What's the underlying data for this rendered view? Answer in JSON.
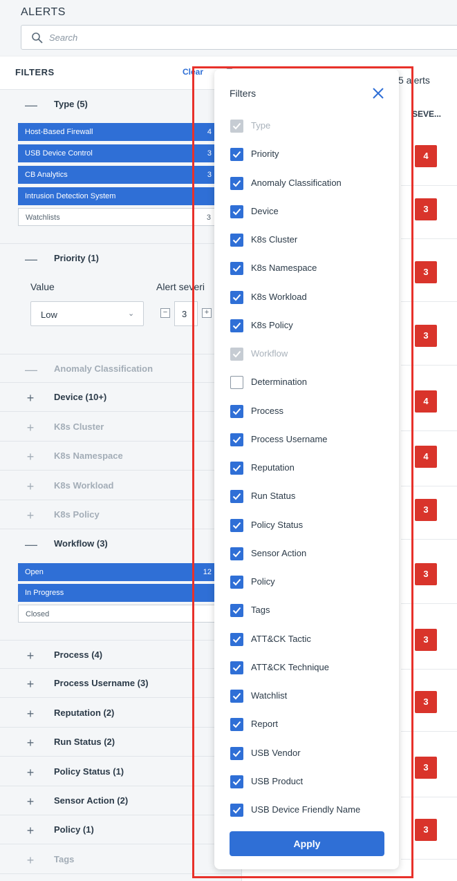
{
  "app": {
    "title": "ALERTS"
  },
  "search": {
    "placeholder": "Search"
  },
  "filters_panel": {
    "title": "FILTERS",
    "clear_label": "Clear",
    "type": {
      "label": "Type (5)",
      "chips": [
        {
          "label": "Host-Based Firewall",
          "count": "4",
          "selected": true
        },
        {
          "label": "USB Device Control",
          "count": "3",
          "selected": true
        },
        {
          "label": "CB Analytics",
          "count": "3",
          "selected": true
        },
        {
          "label": "Intrusion Detection System",
          "count": "",
          "selected": true
        },
        {
          "label": "Watchlists",
          "count": "3",
          "selected": false
        }
      ]
    },
    "priority": {
      "label": "Priority (1)",
      "value_label": "Value",
      "severity_label": "Alert severi",
      "value_selected": "Low",
      "severity_value": "3"
    },
    "collapsed_sections_a": [
      {
        "label": "Anomaly Classification",
        "toggle": "—",
        "muted": true
      },
      {
        "label": "Device (10+)",
        "toggle": "+",
        "muted": false
      },
      {
        "label": "K8s Cluster",
        "toggle": "+",
        "muted": true
      },
      {
        "label": "K8s Namespace",
        "toggle": "+",
        "muted": true
      },
      {
        "label": "K8s Workload",
        "toggle": "+",
        "muted": true
      },
      {
        "label": "K8s Policy",
        "toggle": "+",
        "muted": true
      }
    ],
    "workflow": {
      "label": "Workflow (3)",
      "chips": [
        {
          "label": "Open",
          "count": "12",
          "selected": true
        },
        {
          "label": "In Progress",
          "count": "",
          "selected": true
        },
        {
          "label": "Closed",
          "count": "",
          "selected": false
        }
      ]
    },
    "collapsed_sections_b": [
      {
        "label": "Process (4)",
        "toggle": "+",
        "muted": false
      },
      {
        "label": "Process Username (3)",
        "toggle": "+",
        "muted": false
      },
      {
        "label": "Reputation (2)",
        "toggle": "+",
        "muted": false
      },
      {
        "label": "Run Status (2)",
        "toggle": "+",
        "muted": false
      },
      {
        "label": "Policy Status (1)",
        "toggle": "+",
        "muted": false
      },
      {
        "label": "Sensor Action (2)",
        "toggle": "+",
        "muted": false
      },
      {
        "label": "Policy (1)",
        "toggle": "+",
        "muted": false
      },
      {
        "label": "Tags",
        "toggle": "+",
        "muted": true
      }
    ]
  },
  "alerts_list": {
    "count_label": "5 alerts",
    "severity_header": "SEVE...",
    "severity_badges": [
      "4",
      "3",
      "3",
      "3",
      "4",
      "4",
      "3",
      "3",
      "3",
      "3",
      "3",
      "3"
    ]
  },
  "filters_popover": {
    "title": "Filters",
    "apply_label": "Apply",
    "options": [
      {
        "label": "Type",
        "state": "disabled"
      },
      {
        "label": "Priority",
        "state": "checked"
      },
      {
        "label": "Anomaly Classification",
        "state": "checked"
      },
      {
        "label": "Device",
        "state": "checked"
      },
      {
        "label": "K8s Cluster",
        "state": "checked"
      },
      {
        "label": "K8s Namespace",
        "state": "checked"
      },
      {
        "label": "K8s Workload",
        "state": "checked"
      },
      {
        "label": "K8s Policy",
        "state": "checked"
      },
      {
        "label": "Workflow",
        "state": "disabled"
      },
      {
        "label": "Determination",
        "state": "unchecked"
      },
      {
        "label": "Process",
        "state": "checked"
      },
      {
        "label": "Process Username",
        "state": "checked"
      },
      {
        "label": "Reputation",
        "state": "checked"
      },
      {
        "label": "Run Status",
        "state": "checked"
      },
      {
        "label": "Policy Status",
        "state": "checked"
      },
      {
        "label": "Sensor Action",
        "state": "checked"
      },
      {
        "label": "Policy",
        "state": "checked"
      },
      {
        "label": "Tags",
        "state": "checked"
      },
      {
        "label": "ATT&CK Tactic",
        "state": "checked"
      },
      {
        "label": "ATT&CK Technique",
        "state": "checked"
      },
      {
        "label": "Watchlist",
        "state": "checked"
      },
      {
        "label": "Report",
        "state": "checked"
      },
      {
        "label": "USB Vendor",
        "state": "checked"
      },
      {
        "label": "USB Product",
        "state": "checked"
      },
      {
        "label": "USB Device Friendly Name",
        "state": "checked"
      }
    ]
  },
  "colors": {
    "accent": "#2f6fd6",
    "severity": "#d9342b",
    "highlight": "#e8312a"
  }
}
